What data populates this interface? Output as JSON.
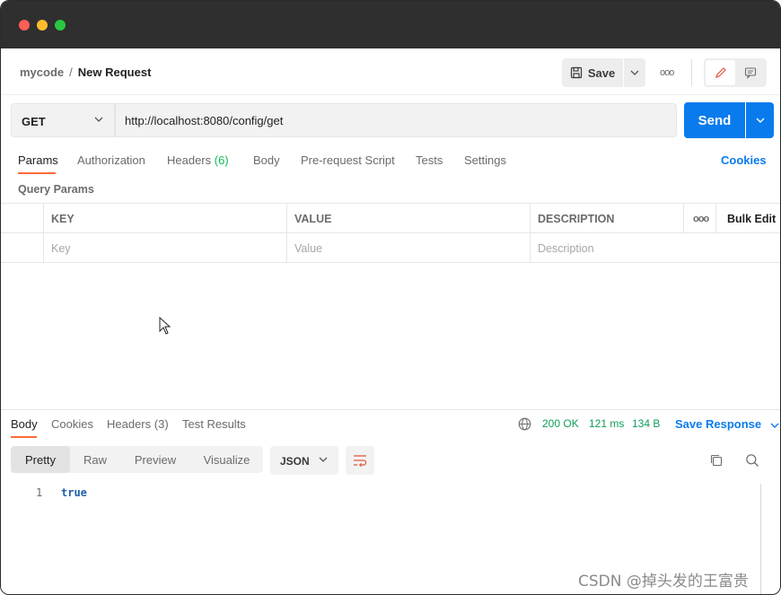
{
  "window": {
    "controls": [
      "close",
      "minimize",
      "zoom"
    ]
  },
  "header": {
    "workspace": "mycode",
    "separator": "/",
    "request_name": "New Request",
    "save_label": "Save",
    "more_icon": "more-horizontal-icon",
    "edit_icon": "pencil-icon",
    "comment_icon": "comment-icon"
  },
  "url_bar": {
    "method": "GET",
    "url": "http://localhost:8080/config/get",
    "send_label": "Send"
  },
  "request_tabs": {
    "items": [
      {
        "label": "Params",
        "active": true
      },
      {
        "label": "Authorization"
      },
      {
        "label": "Headers",
        "count": "(6)"
      },
      {
        "label": "Body"
      },
      {
        "label": "Pre-request Script"
      },
      {
        "label": "Tests"
      },
      {
        "label": "Settings"
      }
    ],
    "cookies_label": "Cookies"
  },
  "query_params": {
    "title": "Query Params",
    "columns": [
      "KEY",
      "VALUE",
      "DESCRIPTION"
    ],
    "more": "ooo",
    "bulk_edit": "Bulk Edit",
    "placeholders": {
      "key": "Key",
      "value": "Value",
      "description": "Description"
    }
  },
  "response": {
    "tabs": [
      {
        "label": "Body",
        "active": true
      },
      {
        "label": "Cookies"
      },
      {
        "label": "Headers",
        "count": "(3)"
      },
      {
        "label": "Test Results"
      }
    ],
    "status": "200 OK",
    "time": "121 ms",
    "size": "134 B",
    "save_response": "Save Response",
    "view_modes": [
      "Pretty",
      "Raw",
      "Preview",
      "Visualize"
    ],
    "active_view": "Pretty",
    "format": "JSON",
    "lines": [
      {
        "n": "1",
        "text": "true"
      }
    ]
  },
  "colors": {
    "accent_orange": "#ff6c37",
    "send_blue": "#097bed",
    "status_green": "#0f9d58"
  },
  "watermark": "CSDN @掉头发的王富贵"
}
